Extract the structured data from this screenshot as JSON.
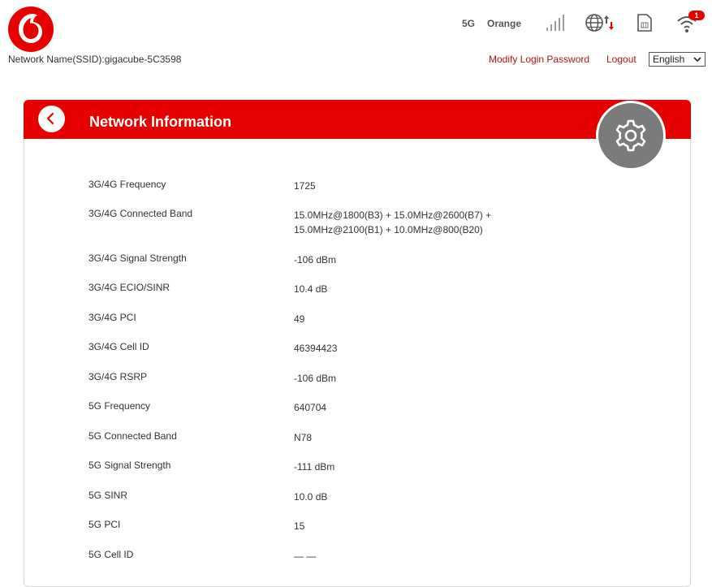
{
  "header": {
    "ssid_text": "Network Name(SSID):gigacube-5C3598",
    "network_type": "5G",
    "operator": "Orange",
    "wifi_clients_count": "1",
    "modify_password_label": "Modify Login Password",
    "logout_label": "Logout",
    "language_selected": "English"
  },
  "icons": {
    "logo": "vodafone-logo-icon",
    "signal": "signal-strength-icon",
    "globe": "internet-connection-icon",
    "sim": "sim-card-icon",
    "wifi": "wifi-icon",
    "back": "back-arrow-icon",
    "settings": "gear-icon"
  },
  "colors": {
    "brand_red": "#e60000",
    "link_red": "#b3141c",
    "settings_gray": "#7b7b7b"
  },
  "card": {
    "title": "Network Information",
    "rows": [
      {
        "label": "3G/4G Frequency",
        "value": "1725"
      },
      {
        "label": "3G/4G Connected Band",
        "value": "15.0MHz@1800(B3) + 15.0MHz@2600(B7) +",
        "value2": "15.0MHz@2100(B1) + 10.0MHz@800(B20)"
      },
      {
        "label": "3G/4G Signal Strength",
        "value": "-106 dBm"
      },
      {
        "label": "3G/4G ECIO/SINR",
        "value": "10.4 dB"
      },
      {
        "label": "3G/4G PCI",
        "value": "49"
      },
      {
        "label": "3G/4G Cell ID",
        "value": "46394423"
      },
      {
        "label": "3G/4G RSRP",
        "value": "-106 dBm"
      },
      {
        "label": "5G Frequency",
        "value": "640704"
      },
      {
        "label": "5G Connected Band",
        "value": "N78"
      },
      {
        "label": "5G Signal Strength",
        "value": "-111 dBm"
      },
      {
        "label": "5G SINR",
        "value": "10.0 dB"
      },
      {
        "label": "5G PCI",
        "value": "15"
      },
      {
        "label": "5G Cell ID",
        "value": "— —"
      }
    ]
  }
}
